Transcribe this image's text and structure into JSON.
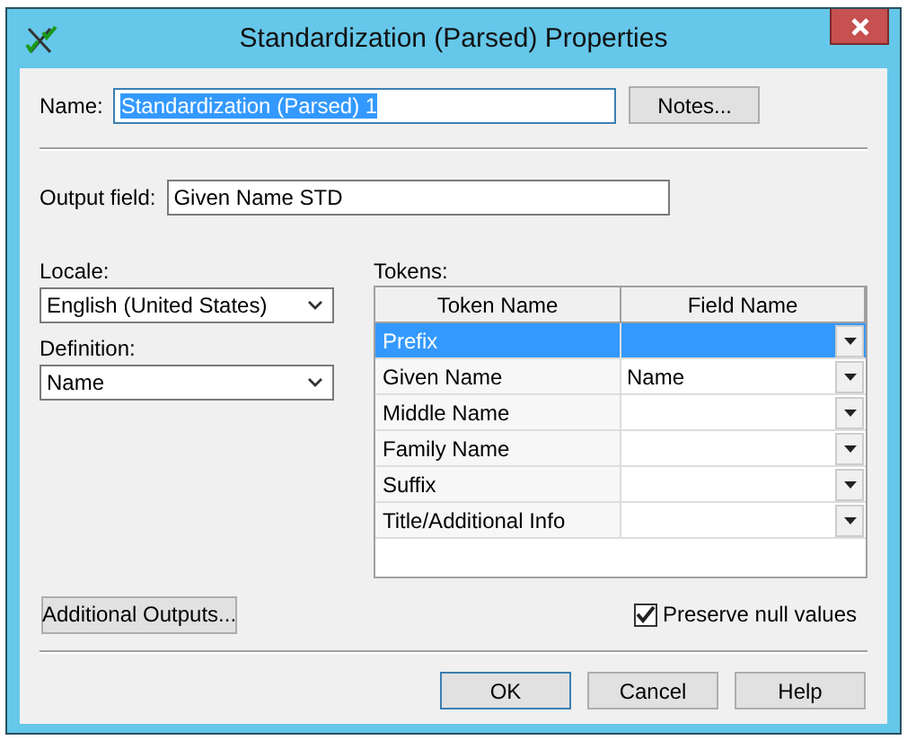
{
  "window": {
    "title": "Standardization (Parsed) Properties"
  },
  "name_field": {
    "label": "Name:",
    "value": "Standardization (Parsed) 1",
    "text_selected": true
  },
  "notes_button": {
    "label": "Notes..."
  },
  "output_field": {
    "label": "Output field:",
    "value": "Given Name STD"
  },
  "locale": {
    "label": "Locale:",
    "value": "English (United States)"
  },
  "definition": {
    "label": "Definition:",
    "value": "Name"
  },
  "tokens": {
    "label": "Tokens:",
    "columns": [
      "Token Name",
      "Field Name"
    ],
    "rows": [
      {
        "token": "Prefix",
        "selected": true
      },
      {
        "token": "Given Name",
        "field": "Name",
        "selected": false
      },
      {
        "token": "Middle Name",
        "selected": false
      },
      {
        "token": "Family Name",
        "selected": false
      },
      {
        "token": "Suffix",
        "selected": false
      },
      {
        "token": "Title/Additional Info",
        "selected": false
      }
    ]
  },
  "additional_outputs_button": {
    "label": "Additional Outputs..."
  },
  "preserve_null": {
    "label": "Preserve null values",
    "checked": true
  },
  "buttons": [
    {
      "label": "OK",
      "default": true
    },
    {
      "label": "Cancel",
      "default": false
    },
    {
      "label": "Help",
      "default": false
    }
  ]
}
